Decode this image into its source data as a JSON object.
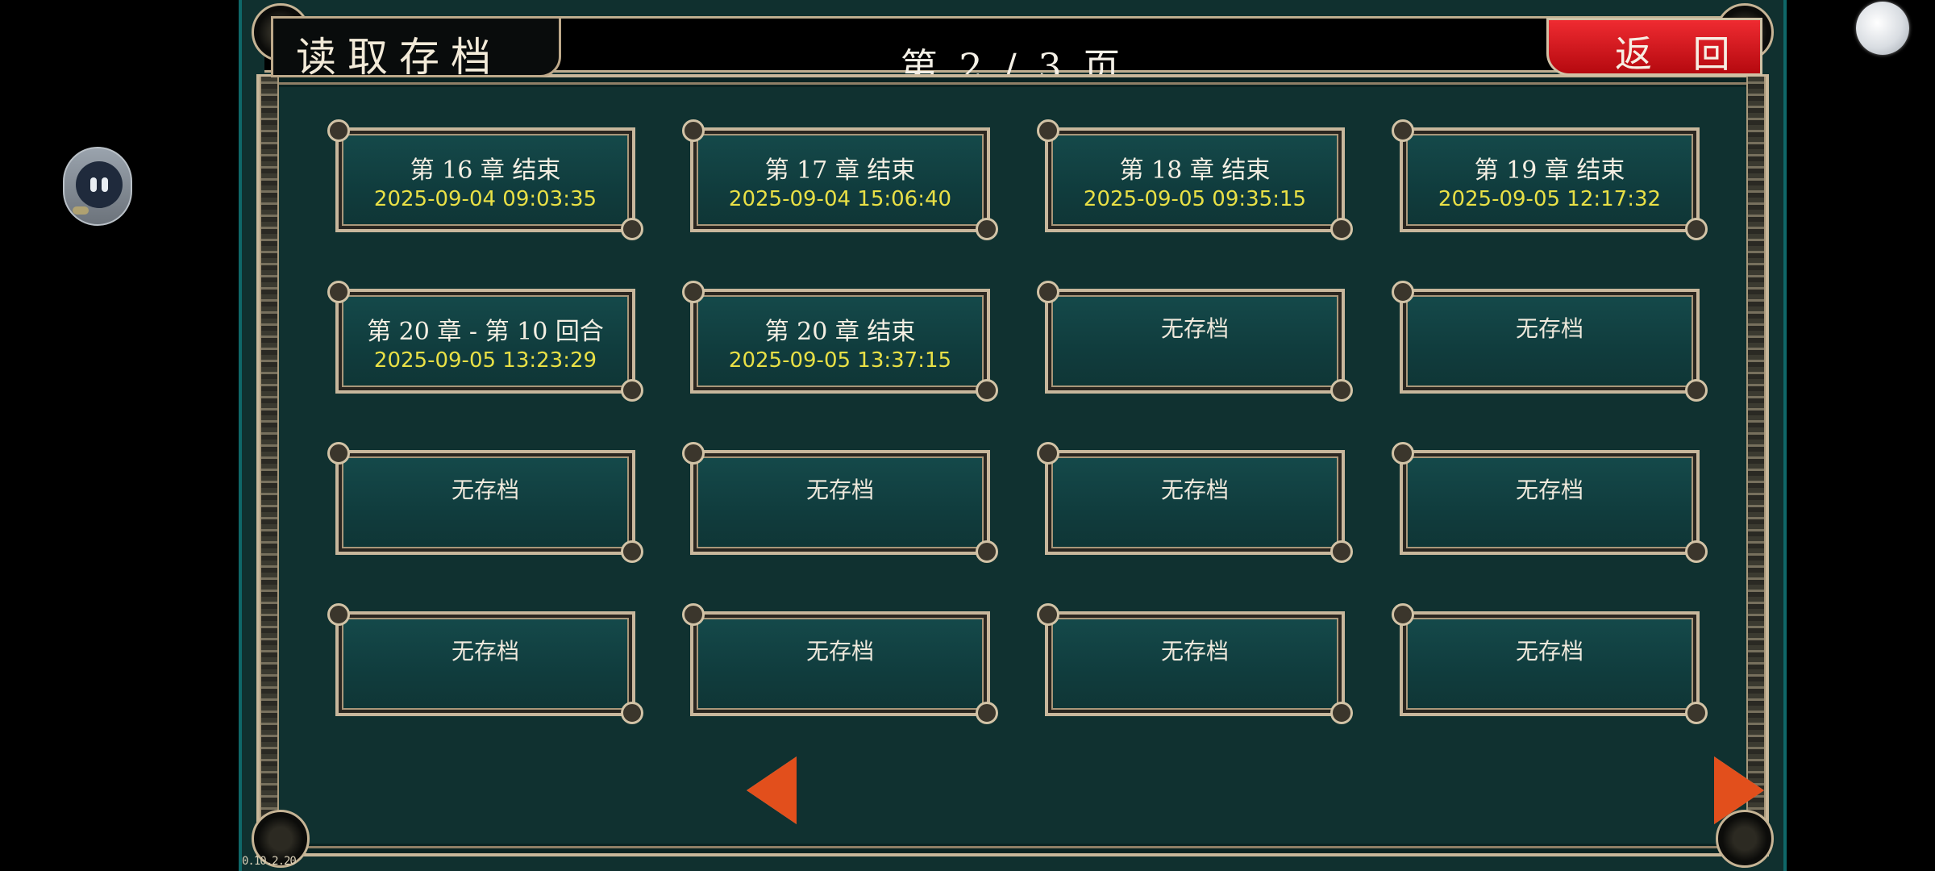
{
  "header": {
    "title": "读取存档",
    "page_indicator": "第 2 / 3 页",
    "back_label": "返 回"
  },
  "slots": [
    {
      "title": "第 16 章 结束",
      "date": "2025-09-04 09:03:35"
    },
    {
      "title": "第 17 章 结束",
      "date": "2025-09-04 15:06:40"
    },
    {
      "title": "第 18 章 结束",
      "date": "2025-09-05 09:35:15"
    },
    {
      "title": "第 19 章 结束",
      "date": "2025-09-05 12:17:32"
    },
    {
      "title": "第 20 章 - 第 10 回合",
      "date": "2025-09-05 13:23:29"
    },
    {
      "title": "第 20 章 结束",
      "date": "2025-09-05 13:37:15"
    }
  ],
  "empty_label": "无存档",
  "version": "0.10.2.20",
  "icons": {
    "prev": "left-arrow-icon",
    "next": "right-arrow-icon"
  },
  "colors": {
    "panel_bg": "#103130",
    "slot_border": "#c8b79c",
    "date_text": "#e9e046",
    "back_button": "#d9161d",
    "arrow": "#e24f1c"
  }
}
